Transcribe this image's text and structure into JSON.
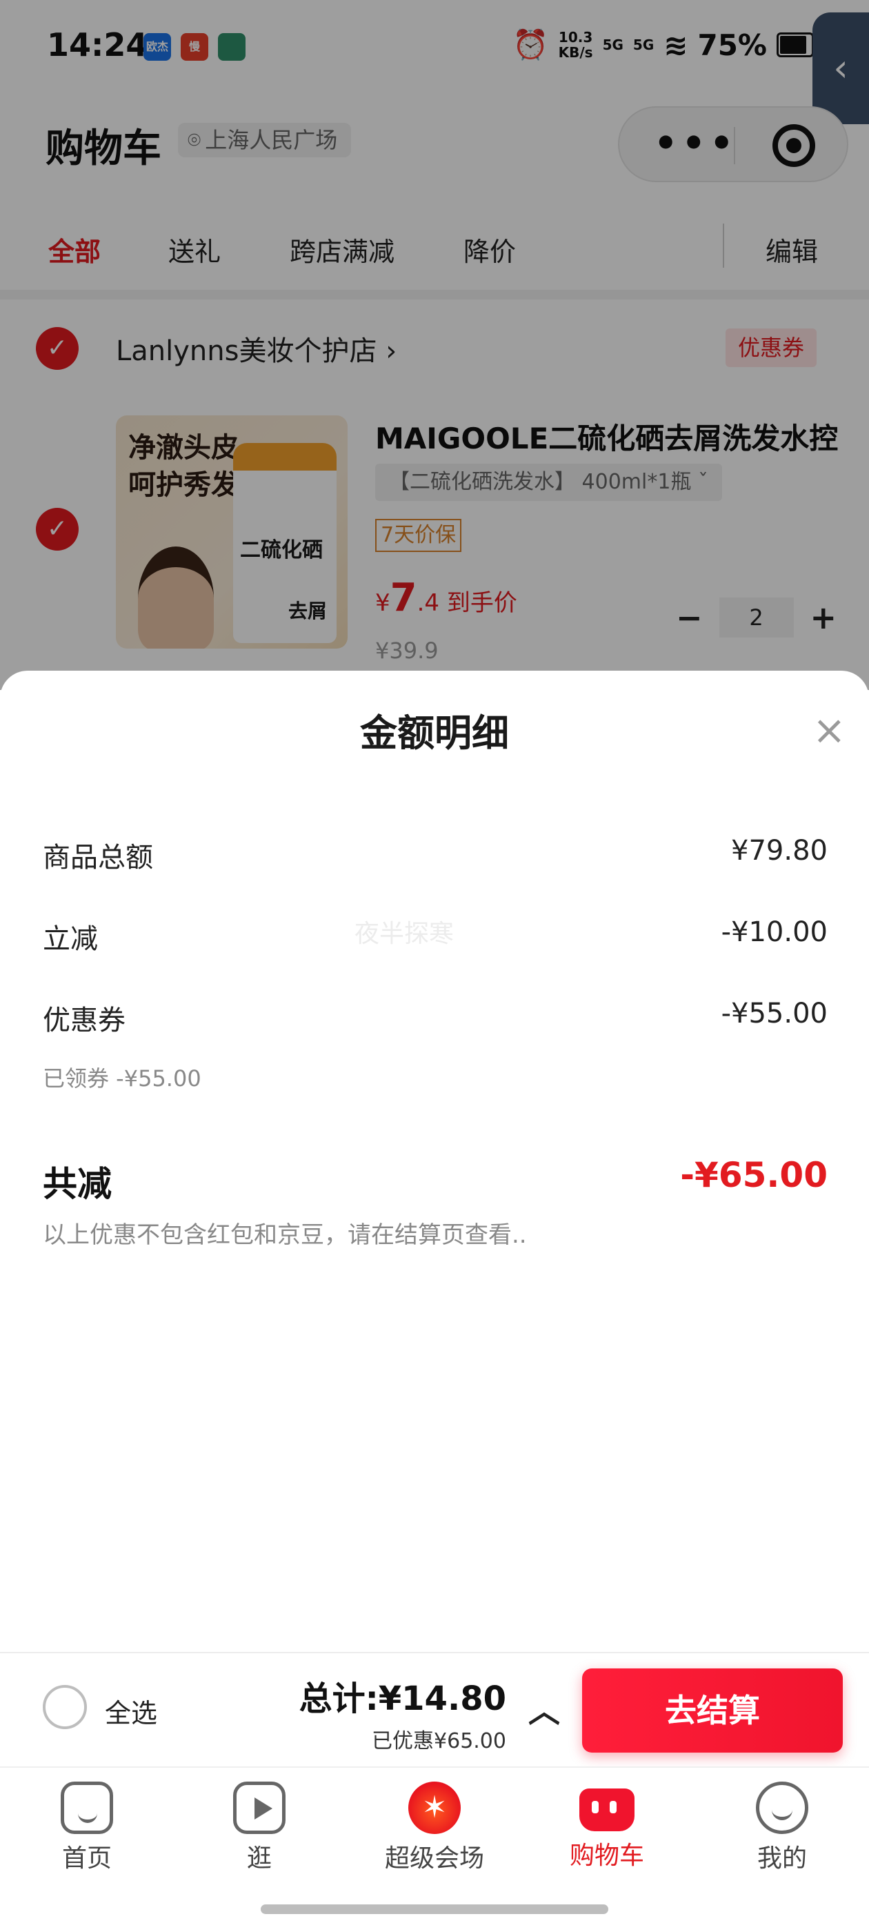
{
  "status_bar": {
    "time": "14:24",
    "app_badges": [
      "欧杰",
      "慢",
      ""
    ],
    "net_speed_value": "10.3",
    "net_speed_unit": "KB/s",
    "signal_1": "5G",
    "signal_2": "5G",
    "battery": "75%"
  },
  "header": {
    "title": "购物车",
    "location": "上海人民广场",
    "capsule_more": "•••"
  },
  "tabs": [
    "全部",
    "送礼",
    "跨店满减",
    "降价"
  ],
  "edit_label": "编辑",
  "store": {
    "name": "Lanlynns美妆个护店 ›",
    "coupon_tag": "优惠券"
  },
  "product": {
    "image_title_line1": "净澈头皮",
    "image_title_line2": "呵护秀发",
    "image_bottle_text": "二硫化硒",
    "image_bottle_word": "去屑",
    "title": "MAIGOOLE二硫化硒去屑洗发水控",
    "sku": "【二硫化硒洗发水】 400ml*1瓶  ˇ",
    "price_protect": "7天价保",
    "price_currency": "¥",
    "price_int": "7",
    "price_dec": ".4",
    "price_suffix": "到手价",
    "price_old": "¥39.9",
    "quantity": "2"
  },
  "sheet": {
    "title": "金额明细",
    "close": "×",
    "watermark": "夜半探寒",
    "rows": [
      {
        "label": "商品总额",
        "value": "¥79.80"
      },
      {
        "label": "立减",
        "value": "-¥10.00"
      },
      {
        "label": "优惠券",
        "value": "-¥55.00",
        "sub": "已领券 -¥55.00"
      }
    ],
    "total_label": "共减",
    "total_value": "-¥65.00",
    "note": "以上优惠不包含红包和京豆，请在结算页查看.."
  },
  "checkout": {
    "select_all": "全选",
    "total": "总计:¥14.80",
    "saved": "已优惠¥65.00",
    "button": "去结算"
  },
  "nav": [
    {
      "label": "首页"
    },
    {
      "label": "逛"
    },
    {
      "label": "超级会场"
    },
    {
      "label": "购物车"
    },
    {
      "label": "我的"
    }
  ],
  "colors": {
    "accent": "#e21b20",
    "checkout_button": "#f0142d"
  }
}
